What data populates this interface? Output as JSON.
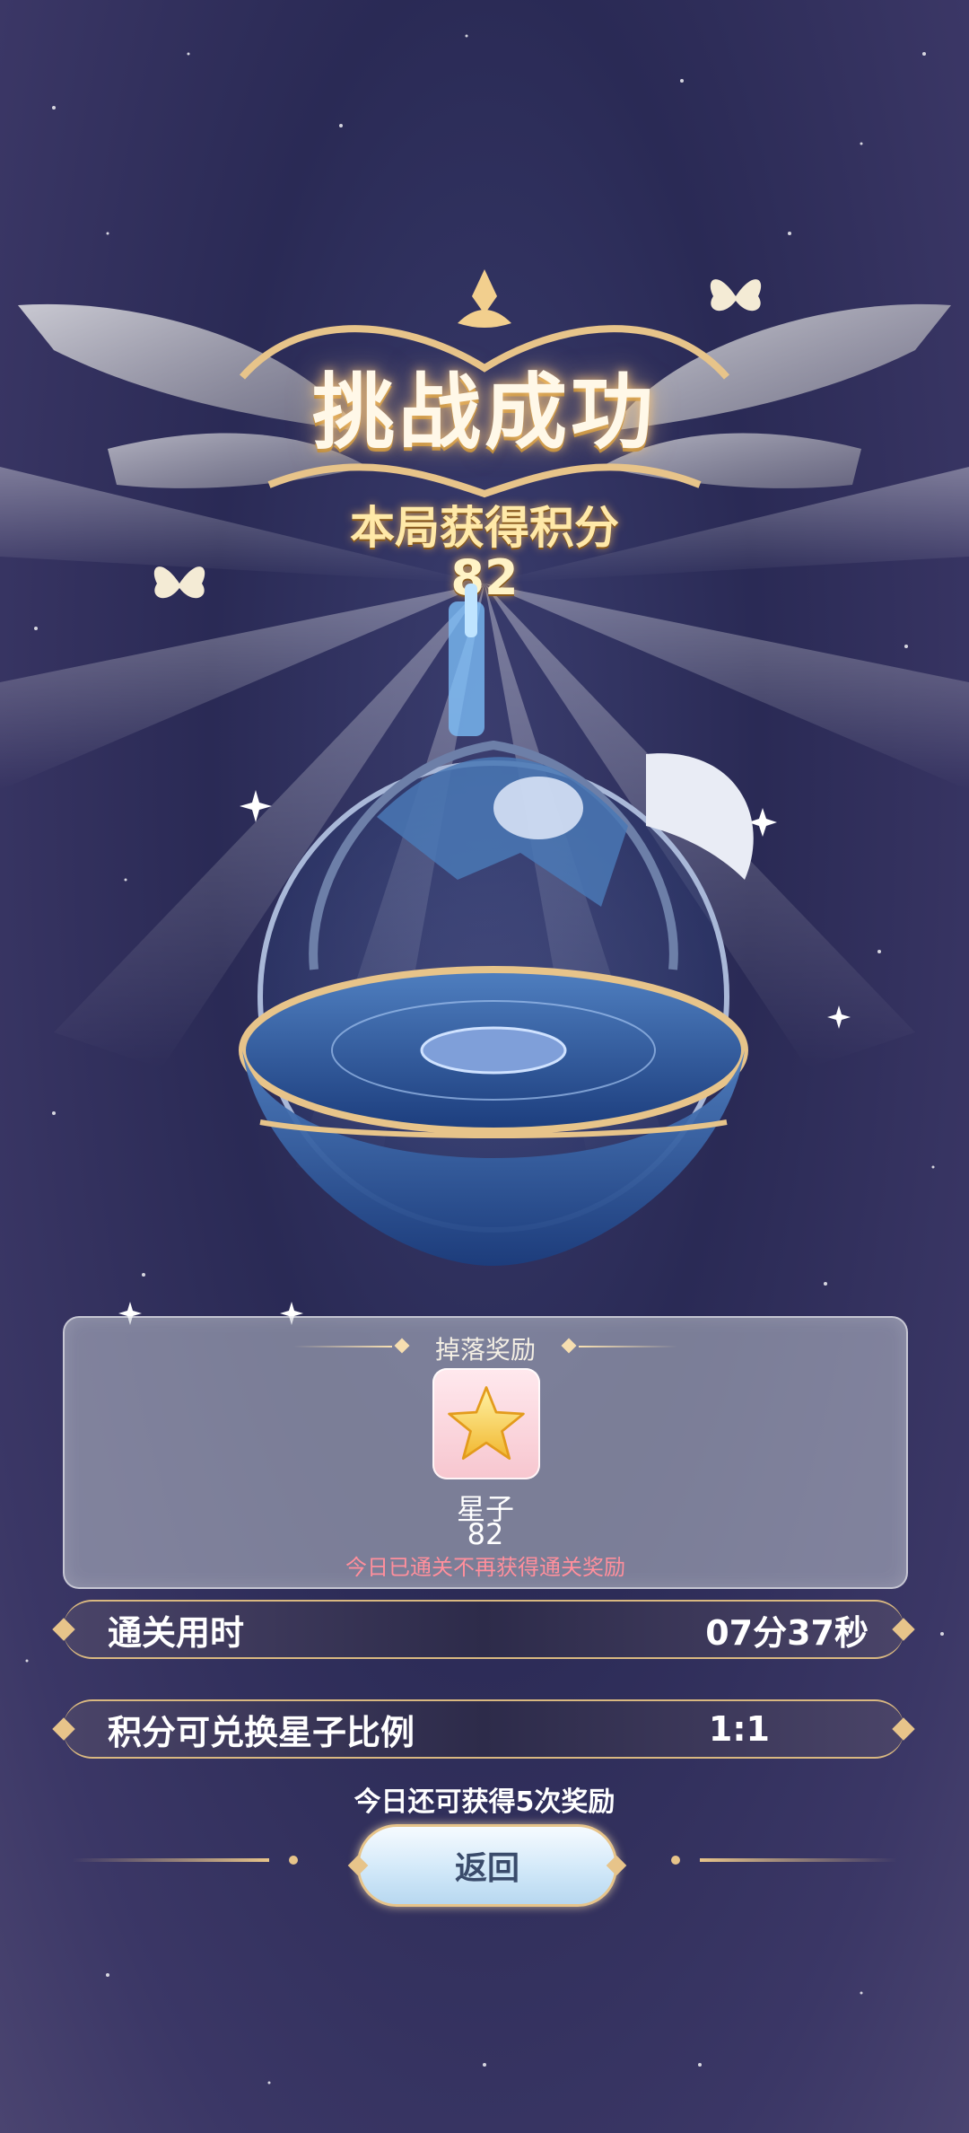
{
  "header": {
    "title": "挑战成功",
    "score_label": "本局获得积分",
    "score_value": "82"
  },
  "reward_panel": {
    "title": "掉落奖励",
    "item": {
      "icon": "star-icon",
      "name": "星子",
      "count": "82"
    },
    "note": "今日已通关不再获得通关奖励"
  },
  "stats": {
    "clear_time_label": "通关用时",
    "clear_time_value": "07分37秒",
    "ratio_label": "积分可兑换星子比例",
    "ratio_value": "1:1"
  },
  "remaining_text": "今日还可获得5次奖励",
  "back_button_label": "返回",
  "colors": {
    "accent_gold": "#e7c48a",
    "note_pink": "#ff8f9c",
    "background": "#2a2a55"
  }
}
